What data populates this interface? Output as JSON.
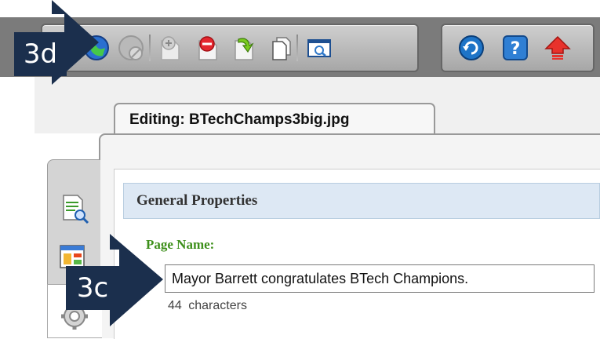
{
  "toolbar": {
    "group1": [
      "publish-icon",
      "unpublish-icon",
      "add-page-icon",
      "remove-page-icon",
      "revert-page-icon",
      "copy-page-icon",
      "preview-icon"
    ],
    "group2": [
      "refresh-icon",
      "help-icon",
      "up-icon"
    ]
  },
  "tab": {
    "label": "Editing: BTechChamps3big.jpg"
  },
  "section": {
    "title": "General Properties"
  },
  "page_name": {
    "label": "Page Name:",
    "value": "Mayor Barrett congratulates BTech Champions.",
    "count": "44",
    "count_suffix": "characters"
  },
  "side_tabs": [
    "page-preview-icon",
    "page-layout-icon",
    "settings-gear-icon"
  ],
  "annotations": {
    "callout_top": "3d",
    "callout_bottom": "3c"
  },
  "colors": {
    "callout_bg": "#1b2f4d",
    "label_green": "#3d8f1a",
    "header_blue": "#dde8f4"
  }
}
